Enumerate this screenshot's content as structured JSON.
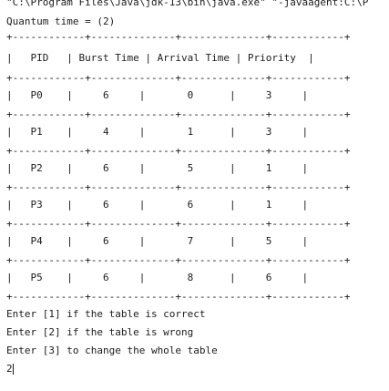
{
  "console": {
    "command_line": "\"C:\\Program Files\\Java\\jdk-13\\bin\\java.exe\" \"-javaagent:C:\\P",
    "quantum_line": "Quantum time = (2)",
    "table": {
      "border": "+------------+--------------+--------------+------------+",
      "header": "|   PID   | Burst Time | Arrival Time | Priority  |",
      "rows": [
        "|   P0    |     6     |       0      |     3     |",
        "|   P1    |     4     |       1      |     3     |",
        "|   P2    |     6     |       5      |     1     |",
        "|   P3    |     6     |       6      |     1     |",
        "|   P4    |     6     |       7      |     5     |",
        "|   P5    |     6     |       8      |     6     |"
      ]
    },
    "prompts": [
      "Enter [1] if the table is correct",
      "Enter [2] if the table is wrong",
      "Enter [3] to change the whole table"
    ],
    "user_input": "2"
  }
}
